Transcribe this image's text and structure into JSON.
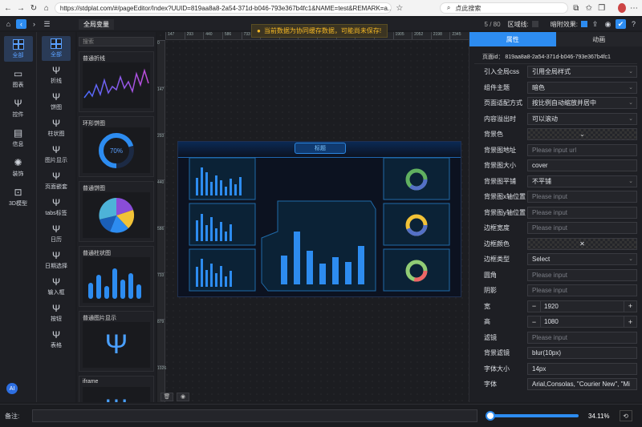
{
  "browser": {
    "url": "https://stdplat.com/#/pageEditor/Index?UUID=819aa8a8-2a54-371d-b046-793e367b4fc1&NAME=test&REMARK=a...",
    "search": "点此搜索"
  },
  "toolbar": {
    "tab": "全局变量",
    "page_count": "5 / 80",
    "area_line": "区域线:",
    "shadow": "暗附效果:"
  },
  "toast": {
    "text": "当前数据为协同缓存数据，可能尚未保存!"
  },
  "nav1": [
    {
      "label": "全部"
    },
    {
      "label": "图表"
    },
    {
      "label": "控件"
    },
    {
      "label": "信息"
    },
    {
      "label": "装饰"
    },
    {
      "label": "3D模型"
    }
  ],
  "nav2": [
    {
      "label": "全部"
    },
    {
      "label": "折线"
    },
    {
      "label": "饼图"
    },
    {
      "label": "柱状图"
    },
    {
      "label": "图片显示"
    },
    {
      "label": "页面嵌套"
    },
    {
      "label": "tabs标签"
    },
    {
      "label": "日历"
    },
    {
      "label": "日期选择"
    },
    {
      "label": "输入框"
    },
    {
      "label": "按钮"
    },
    {
      "label": "表格"
    }
  ],
  "ai": "AI",
  "library": {
    "search_placeholder": "搜索",
    "cards": [
      {
        "title": "普通折线"
      },
      {
        "title": "环形饼图",
        "value": "70%"
      },
      {
        "title": "普通饼图"
      },
      {
        "title": "普通柱状图"
      },
      {
        "title": "普通图片显示"
      },
      {
        "title": "iframe"
      }
    ]
  },
  "rulers": {
    "top": [
      "147",
      "293",
      "440",
      "586",
      "733",
      "879",
      "1026",
      "1172",
      "1319",
      "1466",
      "1612",
      "1759",
      "1905",
      "2052",
      "2198",
      "2345"
    ],
    "left": [
      "0",
      "147",
      "293",
      "440",
      "586",
      "733",
      "879",
      "1026"
    ]
  },
  "screen": {
    "title": "标题"
  },
  "right": {
    "tabs": [
      "属性",
      "动画"
    ],
    "page_id": "页面id： 819aa8a8-2a54-371d-b046-793e367b4fc1",
    "props": [
      {
        "label": "引入全局css",
        "value": "引用全局样式",
        "kind": "select"
      },
      {
        "label": "组件主题",
        "value": "暗色",
        "kind": "select"
      },
      {
        "label": "页面适配方式",
        "value": "按比例自动缩放并居中",
        "kind": "select"
      },
      {
        "label": "内容溢出时",
        "value": "可以滚动",
        "kind": "select"
      },
      {
        "label": "背景色",
        "value": "",
        "kind": "swatch"
      },
      {
        "label": "背景图地址",
        "value": "Please input url",
        "kind": "ph"
      },
      {
        "label": "背景图大小",
        "value": "cover",
        "kind": "text"
      },
      {
        "label": "背景图平铺",
        "value": "不平铺",
        "kind": "select"
      },
      {
        "label": "背景图x轴位置",
        "value": "Please input",
        "kind": "ph"
      },
      {
        "label": "背景图y轴位置",
        "value": "Please input",
        "kind": "ph"
      },
      {
        "label": "边框宽度",
        "value": "Please input",
        "kind": "ph"
      },
      {
        "label": "边框颜色",
        "value": "✕",
        "kind": "swatch"
      },
      {
        "label": "边框类型",
        "value": "Select",
        "kind": "select"
      },
      {
        "label": "圆角",
        "value": "Please input",
        "kind": "ph"
      },
      {
        "label": "阴影",
        "value": "Please input",
        "kind": "ph"
      },
      {
        "label": "宽",
        "value": "1920",
        "kind": "num"
      },
      {
        "label": "高",
        "value": "1080",
        "kind": "num"
      },
      {
        "label": "滤镜",
        "value": "Please input",
        "kind": "ph"
      },
      {
        "label": "背景滤镜",
        "value": "blur(10px)",
        "kind": "text"
      },
      {
        "label": "字体大小",
        "value": "14px",
        "kind": "text"
      },
      {
        "label": "字体",
        "value": "Arial,Consolas, \"Courier New\", \"Mi",
        "kind": "text"
      }
    ]
  },
  "footer": {
    "note_label": "备注:",
    "zoom": "34.11%",
    "zoom_fraction": 0.0
  }
}
